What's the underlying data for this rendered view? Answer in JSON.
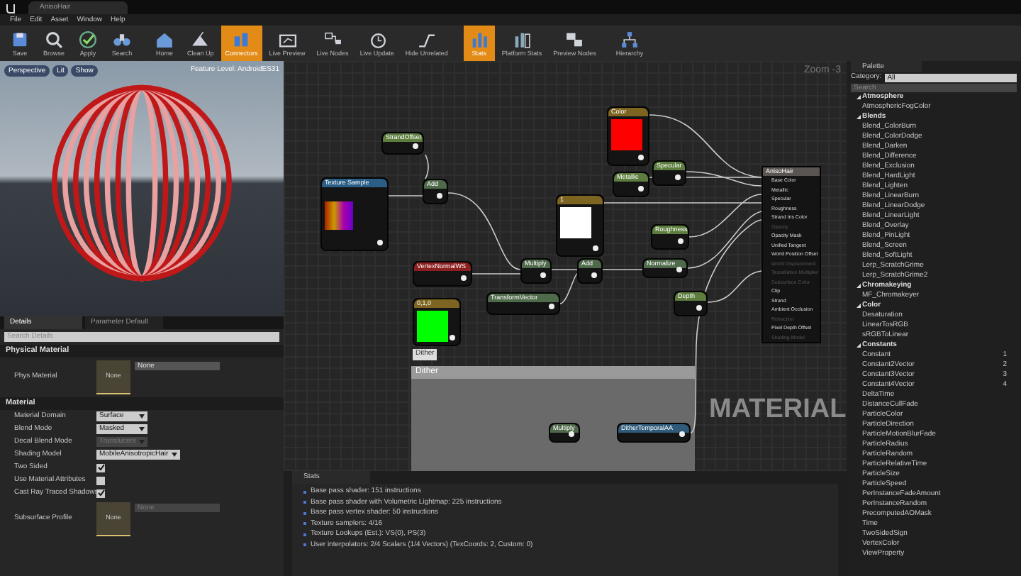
{
  "window": {
    "tab": "AnisoHair"
  },
  "menu": [
    "File",
    "Edit",
    "Asset",
    "Window",
    "Help"
  ],
  "toolbar": [
    {
      "label": "Save",
      "selected": false
    },
    {
      "label": "Browse",
      "selected": false
    },
    {
      "label": "Apply",
      "selected": false
    },
    {
      "label": "Search",
      "selected": false
    },
    {
      "label": "Home",
      "selected": false
    },
    {
      "label": "Clean Up",
      "selected": false
    },
    {
      "label": "Connectors",
      "selected": true
    },
    {
      "label": "Live Preview",
      "selected": false
    },
    {
      "label": "Live Nodes",
      "selected": false
    },
    {
      "label": "Live Update",
      "selected": false
    },
    {
      "label": "Hide Unrelated",
      "selected": false
    },
    {
      "label": "Stats",
      "selected": true
    },
    {
      "label": "Platform Stats",
      "selected": false
    },
    {
      "label": "Preview Nodes",
      "selected": false
    },
    {
      "label": "Hierarchy",
      "selected": false
    }
  ],
  "viewport": {
    "buttons": [
      "Perspective",
      "Lit",
      "Show"
    ],
    "feature_level": "Feature Level: AndroidES31"
  },
  "details": {
    "tabs": [
      {
        "label": "Details",
        "selected": true
      },
      {
        "label": "Parameter Default",
        "selected": false
      }
    ],
    "search_placeholder": "Search Details",
    "sections": [
      {
        "title": "Physical Material",
        "rows": [
          {
            "kind": "asset",
            "label": "Phys Material",
            "thumb": "None",
            "value": "None",
            "disabled": false
          }
        ]
      },
      {
        "title": "Material",
        "rows": [
          {
            "kind": "dropdown",
            "label": "Material Domain",
            "value": "Surface",
            "disabled": false
          },
          {
            "kind": "dropdown",
            "label": "Blend Mode",
            "value": "Masked",
            "disabled": false
          },
          {
            "kind": "dropdown",
            "label": "Decal Blend Mode",
            "value": "Translucent",
            "disabled": true
          },
          {
            "kind": "dropdown",
            "label": "Shading Model",
            "value": "MobileAnisotropicHair",
            "disabled": false
          },
          {
            "kind": "checkbox",
            "label": "Two Sided",
            "checked": true
          },
          {
            "kind": "checkbox",
            "label": "Use Material Attributes",
            "checked": false
          },
          {
            "kind": "checkbox",
            "label": "Cast Ray Traced Shadows",
            "checked": true
          },
          {
            "kind": "asset",
            "label": "Subsurface Profile",
            "thumb": "None",
            "value": "None",
            "disabled": true
          }
        ]
      }
    ]
  },
  "graph": {
    "zoom": "Zoom -3",
    "watermark": "MATERIAL",
    "comment": {
      "tag": "Dither",
      "title": "Dither"
    },
    "nodes": [
      {
        "title": "StrandOffset",
        "kind": "param"
      },
      {
        "title": "Texture Sample",
        "kind": "texture"
      },
      {
        "title": "Add",
        "kind": "math"
      },
      {
        "title": "Color",
        "kind": "vector",
        "color": "#ff0000"
      },
      {
        "title": "Specular",
        "kind": "param"
      },
      {
        "title": "Metallic",
        "kind": "param"
      },
      {
        "title": "1",
        "kind": "vector",
        "color": "#ffffff"
      },
      {
        "title": "Roughness",
        "kind": "param"
      },
      {
        "title": "VertexNormalWS",
        "kind": "input"
      },
      {
        "title": "Multiply",
        "kind": "math"
      },
      {
        "title": "Add",
        "kind": "math"
      },
      {
        "title": "Normalize",
        "kind": "math"
      },
      {
        "title": "0,1,0",
        "kind": "vector",
        "color": "#00ff00"
      },
      {
        "title": "TransformVector",
        "kind": "math"
      },
      {
        "title": "Depth",
        "kind": "param"
      },
      {
        "title": "Multiply",
        "kind": "math"
      },
      {
        "title": "DitherTemporalAA",
        "kind": "function"
      }
    ],
    "result": {
      "title": "AnisoHair",
      "pins": [
        {
          "label": "Base Color",
          "disabled": false
        },
        {
          "label": "Metallic",
          "disabled": false
        },
        {
          "label": "Specular",
          "disabled": false
        },
        {
          "label": "Roughness",
          "disabled": false
        },
        {
          "label": "Strand Iris Color",
          "disabled": false
        },
        {
          "label": "Opacity",
          "disabled": true
        },
        {
          "label": "Opacity Mask",
          "disabled": false
        },
        {
          "label": "Unified Tangent",
          "disabled": false
        },
        {
          "label": "World Position Offset",
          "disabled": false
        },
        {
          "label": "World Displacement",
          "disabled": true
        },
        {
          "label": "Tessellation Multiplier",
          "disabled": true
        },
        {
          "label": "Subsurface Color",
          "disabled": true
        },
        {
          "label": "Clip",
          "disabled": false
        },
        {
          "label": "Strand",
          "disabled": false
        },
        {
          "label": "Ambient Occlusion",
          "disabled": false
        },
        {
          "label": "Refraction",
          "disabled": true
        },
        {
          "label": "Pixel Depth Offset",
          "disabled": false
        },
        {
          "label": "Shading Model",
          "disabled": true
        }
      ]
    }
  },
  "stats": {
    "tab": "Stats",
    "lines": [
      "Base pass shader: 151 instructions",
      "Base pass shader with Volumetric Lightmap: 225 instructions",
      "Base pass vertex shader: 50 instructions",
      "Texture samplers: 4/16",
      "Texture Lookups (Est.): VS(0), PS(3)",
      "User interpolators: 2/4 Scalars (1/4 Vectors) (TexCoords: 2, Custom: 0)"
    ]
  },
  "palette": {
    "tab": "Palette",
    "category_label": "Category:",
    "category": "All",
    "search_placeholder": "Search",
    "groups": [
      {
        "name": "Atmosphere",
        "items": [
          {
            "label": "AtmosphericFogColor"
          }
        ]
      },
      {
        "name": "Blends",
        "items": [
          {
            "label": "Blend_ColorBurn"
          },
          {
            "label": "Blend_ColorDodge"
          },
          {
            "label": "Blend_Darken"
          },
          {
            "label": "Blend_Difference"
          },
          {
            "label": "Blend_Exclusion"
          },
          {
            "label": "Blend_HardLight"
          },
          {
            "label": "Blend_Lighten"
          },
          {
            "label": "Blend_LinearBurn"
          },
          {
            "label": "Blend_LinearDodge"
          },
          {
            "label": "Blend_LinearLight"
          },
          {
            "label": "Blend_Overlay"
          },
          {
            "label": "Blend_PinLight"
          },
          {
            "label": "Blend_Screen"
          },
          {
            "label": "Blend_SoftLight"
          },
          {
            "label": "Lerp_ScratchGrime"
          },
          {
            "label": "Lerp_ScratchGrime2"
          }
        ]
      },
      {
        "name": "Chromakeying",
        "items": [
          {
            "label": "MF_Chromakeyer"
          }
        ]
      },
      {
        "name": "Color",
        "items": [
          {
            "label": "Desaturation"
          },
          {
            "label": "LinearTosRGB"
          },
          {
            "label": "sRGBToLinear"
          }
        ]
      },
      {
        "name": "Constants",
        "items": [
          {
            "label": "Constant",
            "hotkey": "1"
          },
          {
            "label": "Constant2Vector",
            "hotkey": "2"
          },
          {
            "label": "Constant3Vector",
            "hotkey": "3"
          },
          {
            "label": "Constant4Vector",
            "hotkey": "4"
          },
          {
            "label": "DeltaTime"
          },
          {
            "label": "DistanceCullFade"
          },
          {
            "label": "ParticleColor"
          },
          {
            "label": "ParticleDirection"
          },
          {
            "label": "ParticleMotionBlurFade"
          },
          {
            "label": "ParticleRadius"
          },
          {
            "label": "ParticleRandom"
          },
          {
            "label": "ParticleRelativeTime"
          },
          {
            "label": "ParticleSize"
          },
          {
            "label": "ParticleSpeed"
          },
          {
            "label": "PerInstanceFadeAmount"
          },
          {
            "label": "PerInstanceRandom"
          },
          {
            "label": "PrecomputedAOMask"
          },
          {
            "label": "Time"
          },
          {
            "label": "TwoSidedSign"
          },
          {
            "label": "VertexColor"
          },
          {
            "label": "ViewProperty"
          }
        ]
      }
    ]
  }
}
